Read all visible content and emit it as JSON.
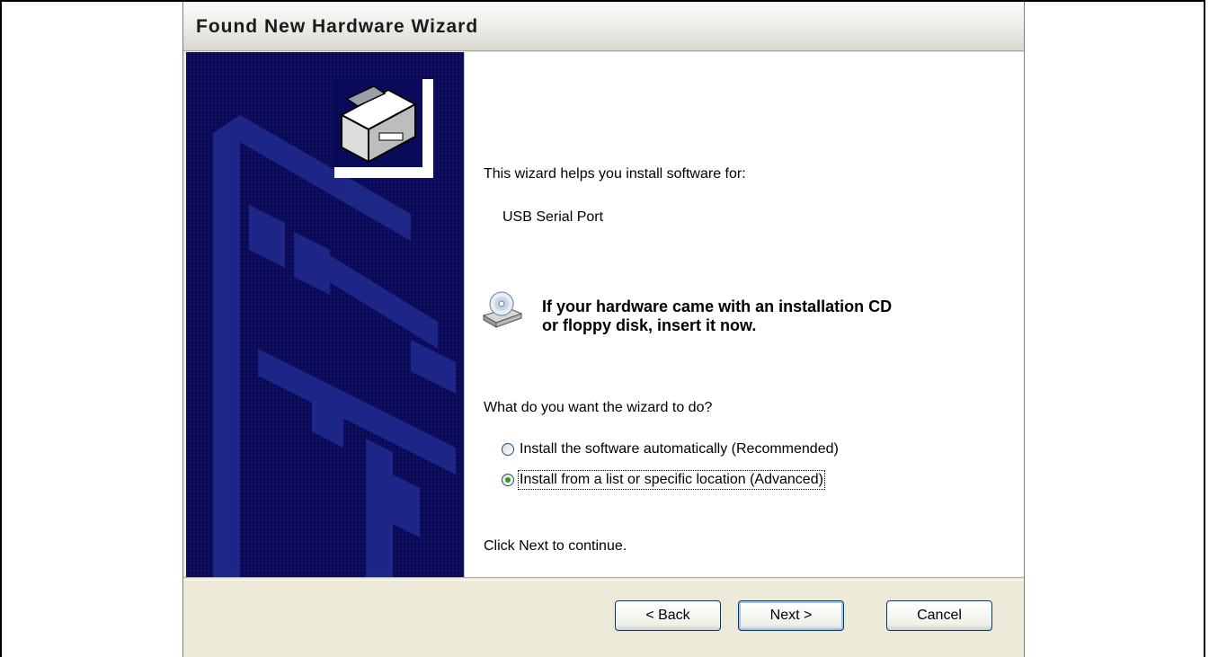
{
  "window": {
    "title": "Found New Hardware Wizard"
  },
  "content": {
    "intro": "This wizard helps you install software for:",
    "device": "USB Serial Port",
    "cd_line1": "If your hardware came with an installation CD",
    "cd_line2": "or floppy disk, insert it now.",
    "question": "What do you want the wizard to do?",
    "option_auto": "Install the software automatically (Recommended)",
    "option_advanced": "Install from a list or specific location (Advanced)",
    "selected_option": "option_advanced",
    "continue_hint": "Click Next to continue."
  },
  "buttons": {
    "back": "< Back",
    "next": "Next >",
    "cancel": "Cancel"
  },
  "icons": {
    "hardware": "hardware-card-icon",
    "cd": "cd-drive-icon",
    "radio_checked_color": "#21a121"
  }
}
